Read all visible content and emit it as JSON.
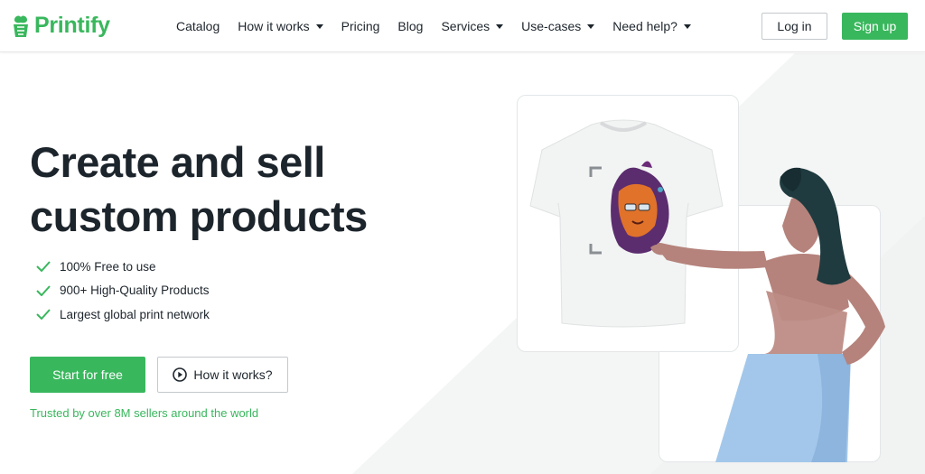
{
  "brand": {
    "name": "Printify",
    "color": "#39b75d",
    "icon": "printify-logo-icon"
  },
  "nav": {
    "items": [
      {
        "label": "Catalog",
        "dropdown": false
      },
      {
        "label": "How it works",
        "dropdown": true
      },
      {
        "label": "Pricing",
        "dropdown": false
      },
      {
        "label": "Blog",
        "dropdown": false
      },
      {
        "label": "Services",
        "dropdown": true
      },
      {
        "label": "Use-cases",
        "dropdown": true
      },
      {
        "label": "Need help?",
        "dropdown": true
      }
    ]
  },
  "auth": {
    "login_label": "Log in",
    "signup_label": "Sign up"
  },
  "hero": {
    "title_line1": "Create and sell",
    "title_line2": "custom products",
    "features": [
      "100% Free to use",
      "900+ High-Quality Products",
      "Largest global print network"
    ],
    "cta_primary": "Start for free",
    "cta_secondary": "How it works?",
    "trusted": "Trusted by over 8M sellers around the world"
  },
  "illustration": {
    "product": "t-shirt-with-lion-design",
    "character": "woman-pointing-at-shirt"
  },
  "colors": {
    "accent": "#39b75d",
    "text": "#1d252c",
    "background_diagonal": "#f4f5f5",
    "skirt": "#a3c7ea"
  }
}
